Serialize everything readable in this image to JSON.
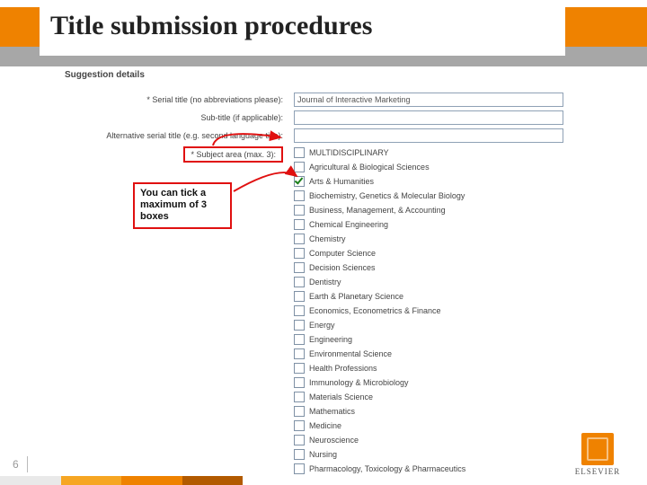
{
  "slide": {
    "title": "Title submission procedures",
    "number": "6"
  },
  "form": {
    "section_title": "Suggestion details",
    "serial_title_label": "* Serial title (no abbreviations please):",
    "serial_title_value": "Journal of Interactive Marketing",
    "sub_title_label": "Sub-title (if applicable):",
    "sub_title_value": "",
    "alt_title_label": "Alternative serial title (e.g. second language title):",
    "alt_title_value": "",
    "subject_label": "* Subject area (max. 3):",
    "subjects": [
      {
        "label": "MULTIDISCIPLINARY",
        "checked": false
      },
      {
        "label": "Agricultural & Biological Sciences",
        "checked": false
      },
      {
        "label": "Arts & Humanities",
        "checked": true
      },
      {
        "label": "Biochemistry, Genetics & Molecular Biology",
        "checked": false
      },
      {
        "label": "Business, Management, & Accounting",
        "checked": false
      },
      {
        "label": "Chemical Engineering",
        "checked": false
      },
      {
        "label": "Chemistry",
        "checked": false
      },
      {
        "label": "Computer Science",
        "checked": false
      },
      {
        "label": "Decision Sciences",
        "checked": false
      },
      {
        "label": "Dentistry",
        "checked": false
      },
      {
        "label": "Earth & Planetary Science",
        "checked": false
      },
      {
        "label": "Economics, Econometrics & Finance",
        "checked": false
      },
      {
        "label": "Energy",
        "checked": false
      },
      {
        "label": "Engineering",
        "checked": false
      },
      {
        "label": "Environmental Science",
        "checked": false
      },
      {
        "label": "Health Professions",
        "checked": false
      },
      {
        "label": "Immunology & Microbiology",
        "checked": false
      },
      {
        "label": "Materials Science",
        "checked": false
      },
      {
        "label": "Mathematics",
        "checked": false
      },
      {
        "label": "Medicine",
        "checked": false
      },
      {
        "label": "Neuroscience",
        "checked": false
      },
      {
        "label": "Nursing",
        "checked": false
      },
      {
        "label": "Pharmacology, Toxicology & Pharmaceutics",
        "checked": false
      }
    ]
  },
  "annotation": {
    "text": "You can tick a maximum of 3 boxes"
  },
  "logo": {
    "text": "ELSEVIER"
  }
}
